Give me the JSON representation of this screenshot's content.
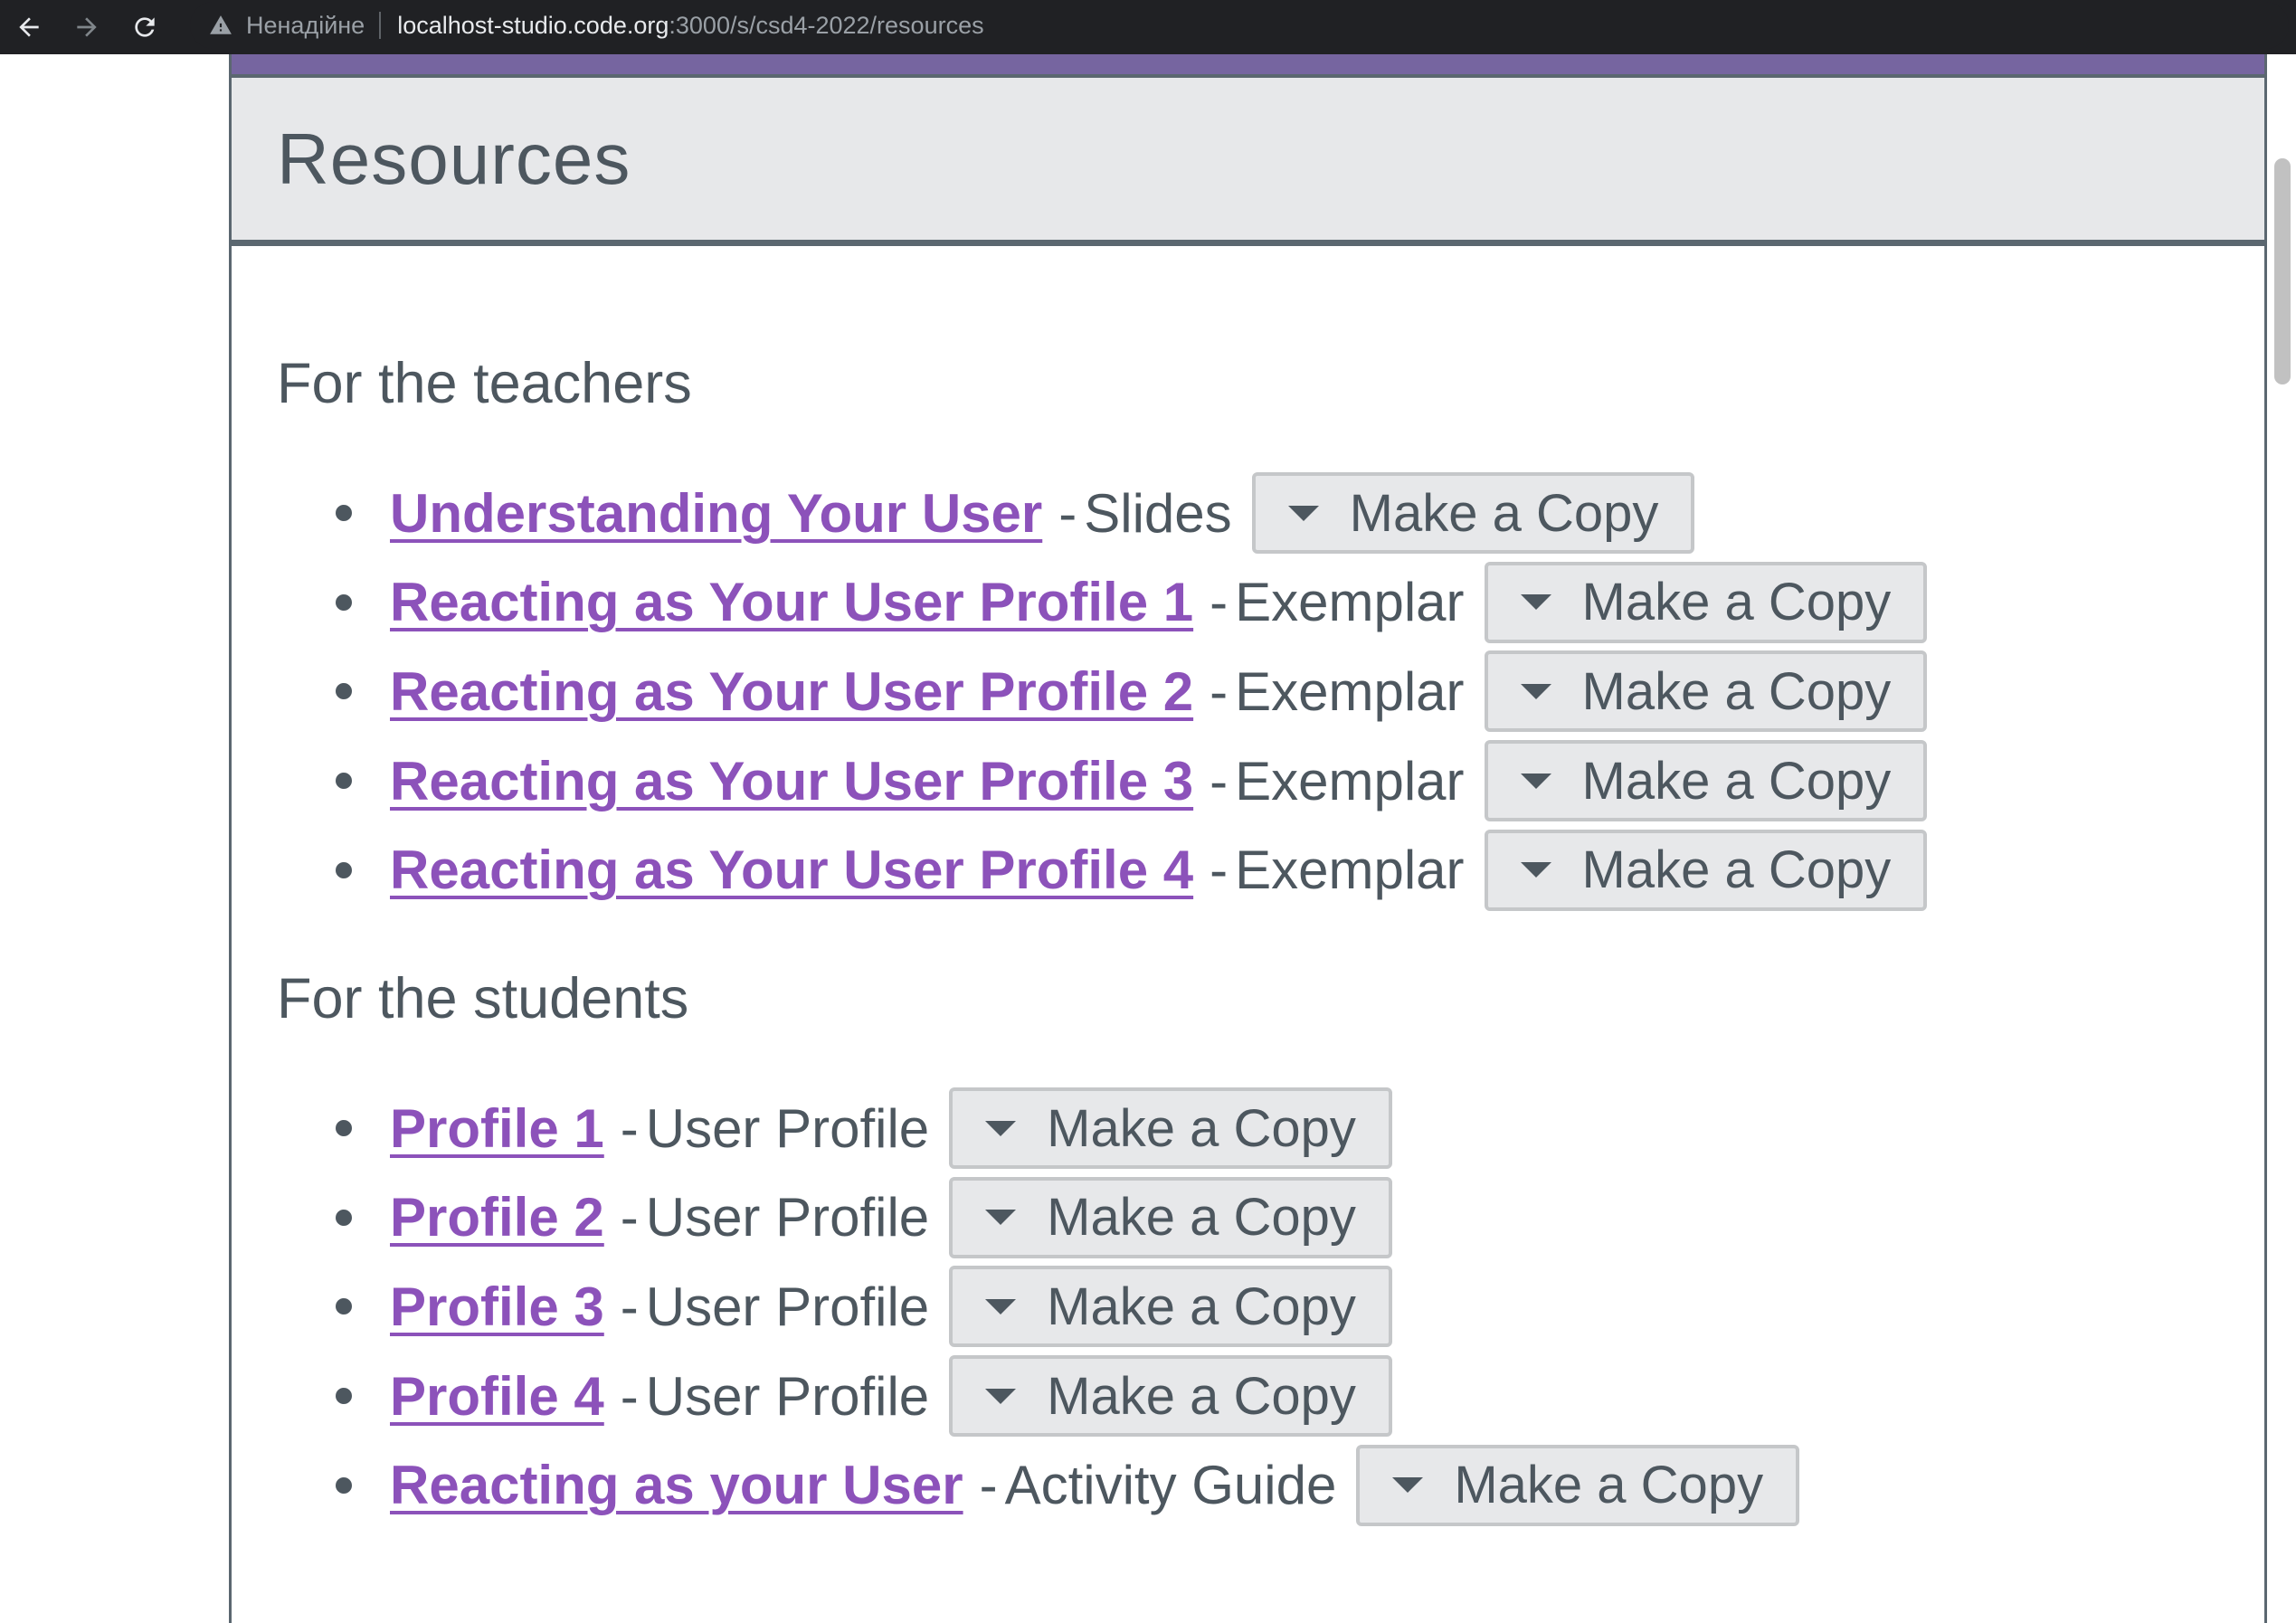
{
  "browser": {
    "security_label": "Ненадійне",
    "url_host": "localhost-studio.code.org",
    "url_path": ":3000/s/csd4-2022/resources"
  },
  "page": {
    "title": "Resources",
    "copy_button_label": "Make a Copy",
    "sections": [
      {
        "heading": "For the teachers",
        "items": [
          {
            "link": "Understanding Your User",
            "type": "Slides"
          },
          {
            "link": "Reacting as Your User Profile 1",
            "type": "Exemplar"
          },
          {
            "link": "Reacting as Your User Profile 2",
            "type": "Exemplar"
          },
          {
            "link": "Reacting as Your User Profile 3",
            "type": "Exemplar"
          },
          {
            "link": "Reacting as Your User Profile 4",
            "type": "Exemplar"
          }
        ]
      },
      {
        "heading": "For the students",
        "items": [
          {
            "link": "Profile 1",
            "type": "User Profile"
          },
          {
            "link": "Profile 2",
            "type": "User Profile"
          },
          {
            "link": "Profile 3",
            "type": "User Profile"
          },
          {
            "link": "Profile 4",
            "type": "User Profile"
          },
          {
            "link": "Reacting as your User",
            "type": "Activity Guide"
          }
        ]
      }
    ]
  },
  "colors": {
    "link": "#8c52ba",
    "text": "#4d575f",
    "header_bg": "#e7e8ea",
    "accent_strip": "#7665a0"
  }
}
